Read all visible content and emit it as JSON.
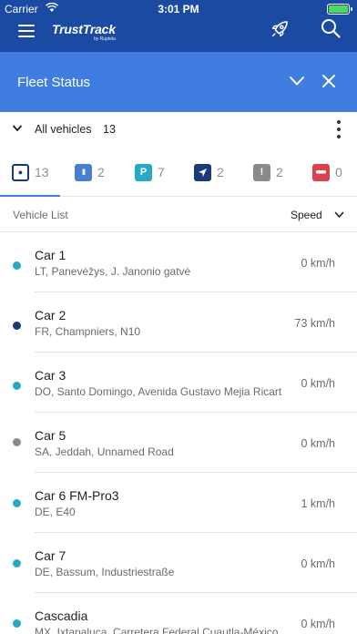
{
  "status_bar": {
    "carrier": "Carrier",
    "time": "3:01 PM"
  },
  "app": {
    "logo_name": "TrustTrack",
    "logo_sub": "by Ruptela"
  },
  "fleet": {
    "title": "Fleet Status"
  },
  "filter": {
    "label": "All vehicles",
    "count": "13"
  },
  "status_tabs": [
    {
      "name": "all",
      "count": "13",
      "glyph": "●",
      "color": "#1b3a7a"
    },
    {
      "name": "paused",
      "count": "2",
      "glyph": "II",
      "color": "#4a7fcf"
    },
    {
      "name": "parked",
      "count": "7",
      "glyph": "P",
      "color": "#26a9c7"
    },
    {
      "name": "moving",
      "count": "2",
      "glyph": "➤",
      "color": "#1b3a7a"
    },
    {
      "name": "alert",
      "count": "2",
      "glyph": "!",
      "color": "#8a8a8a"
    },
    {
      "name": "blocked",
      "count": "0",
      "glyph": "—",
      "color": "#e0404c"
    }
  ],
  "list": {
    "title": "Vehicle List",
    "sort_label": "Speed"
  },
  "vehicles": [
    {
      "name": "Car 1",
      "address": "LT, Panevėžys, J. Janonio gatvė",
      "speed": "0 km/h",
      "status_color": "#26a9c7"
    },
    {
      "name": "Car 2",
      "address": "FR, Champniers, N10",
      "speed": "73 km/h",
      "status_color": "#1b3a7a"
    },
    {
      "name": "Car 3",
      "address": "DO, Santo Domingo, Avenida Gustavo Mejia Ricart",
      "speed": "0 km/h",
      "status_color": "#26a9c7"
    },
    {
      "name": "Car 5",
      "address": "SA, Jeddah, Unnamed Road",
      "speed": "0 km/h",
      "status_color": "#8a8a8a"
    },
    {
      "name": "Car 6 FM-Pro3",
      "address": "DE, E40",
      "speed": "1 km/h",
      "status_color": "#26a9c7"
    },
    {
      "name": "Car 7",
      "address": "DE, Bassum, Industriestraße",
      "speed": "0 km/h",
      "status_color": "#26a9c7"
    },
    {
      "name": "Cascadia",
      "address": "MX, Ixtapaluca, Carretera Federal Cuautla-México",
      "speed": "0 km/h",
      "status_color": "#26a9c7"
    }
  ]
}
